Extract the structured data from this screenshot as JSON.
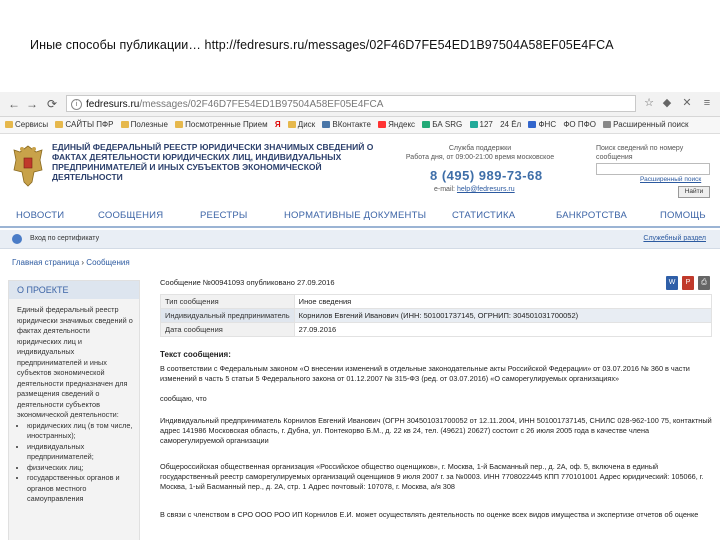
{
  "caption": "Иные способы публикации… http://fedresurs.ru/messages/02F46D7FE54ED1B97504A58EF05E4FCA",
  "browser": {
    "url_host": "fedresurs.ru",
    "url_path": "/messages/02F46D7FE54ED1B97504A58EF05E4FCA",
    "bookmarks": [
      "Сервисы",
      "САЙТЫ ПФР",
      "Полезные",
      "Посмотренные Прием",
      "Я",
      "Диск",
      "ВКонтакте",
      "Яндекс",
      "БА SRG",
      "127",
      "24 Ёл",
      "ФНС",
      "ФО ПФО",
      "Расширенный поиск"
    ]
  },
  "header": {
    "registry_title": "Единый федеральный реестр юридически значимых сведений о фактах деятельности юридических лиц, индивидуальных предпринимателей и иных субъектов экономической деятельности",
    "support_title": "Служба поддержки",
    "support_hours": "Работа дня, от 09:00-21:00 время московское",
    "phone": "8 (495) 989-73-68",
    "email_label": "e-mail:",
    "email": "help@fedresurs.ru",
    "search_label": "Поиск сведений по номеру сообщения",
    "search_placeholder": "",
    "advanced_search": "Расширенный поиск",
    "search_button": "Найти"
  },
  "nav": [
    "Новости",
    "Сообщения",
    "Реестры",
    "Нормативные документы",
    "Статистика",
    "Банкротства",
    "Помощь"
  ],
  "cert_bar": {
    "text": "Вход по сертификату",
    "link": "Служебный раздел"
  },
  "breadcrumb": {
    "home": "Главная страница",
    "separator": "›",
    "current": "Сообщения"
  },
  "sidebar": {
    "title": "О проекте",
    "intro": "Единый федеральный реестр юридически значимых сведений о фактах деятельности юридических лиц и индивидуальных предпринимателей и иных субъектов экономической деятельности предназначен для размещения сведений о деятельности субъектов экономической деятельности:",
    "items": [
      "юридических лиц (в том числе, иностранных);",
      "индивидуальных предпринимателей;",
      "физических лиц;",
      "государственных органов и органов местного самоуправления"
    ]
  },
  "message": {
    "header": "Сообщение №00941093 опубликовано 27.09.2016",
    "rows": [
      {
        "key": "Тип сообщения",
        "value": "Иное сведения"
      },
      {
        "key": "Индивидуальный предприниматель",
        "value": "Корнилов Евгений Иванович (ИНН: 501001737145, ОГРНИП: 304501031700052)"
      },
      {
        "key": "Дата сообщения",
        "value": "27.09.2016"
      }
    ],
    "text_title": "Текст сообщения:",
    "paragraphs": [
      "В соответствии с Федеральным законом «О внесении изменений в отдельные законодательные акты Российской Федерации» от 03.07.2016 № 360 в части изменений в часть 5 статьи 5 Федерального закона от 01.12.2007 № 315-ФЗ (ред. от 03.07.2016) «О саморегулируемых организациях»",
      "сообщаю, что",
      "Индивидуальный предприниматель Корнилов Евгений Иванович (ОГРН 304501031700052 от 12.11.2004, ИНН 501001737145, СНИЛС 028-962-100 75, контактный адрес 141986 Московская область, г. Дубна, ул. Понтекорво Б.М., д. 22 кв 24, тел. (49621) 20627) состоит с 26 июля 2005 года в качестве члена саморегулируемой организации",
      "Общероссийская общественная организация «Российское общество оценщиков», г. Москва, 1-й Басманный пер., д. 2А, оф. 5, включена в единый государственный реестр саморегулируемых организаций оценщиков 9 июля 2007 г. за №0003. ИНН 7708022445 КПП 770101001 Адрес юридический: 105066, г. Москва, 1-ый Басманный пер., д. 2А, стр. 1 Адрес почтовый: 107078, г. Москва, а/я 308",
      "В связи с членством в СРО ООО РОО ИП Корнилов Е.И. может осуществлять деятельность по оценке всех видов имущества и экспертизе отчетов об оценке"
    ]
  },
  "colors": {
    "nav_text": "#3c64a6",
    "phone": "#3e6ea8",
    "header_title": "#2b3f6b"
  }
}
